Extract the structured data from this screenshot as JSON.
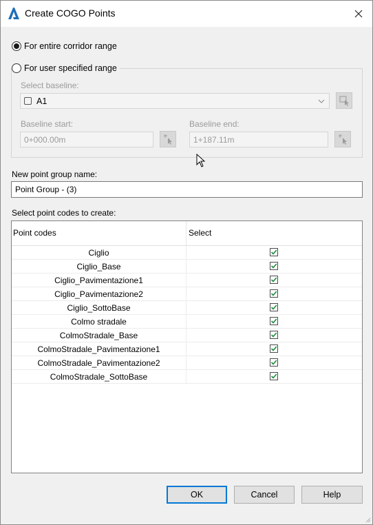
{
  "window": {
    "title": "Create COGO Points"
  },
  "range": {
    "entire": {
      "label": "For entire corridor range",
      "checked": true
    },
    "user": {
      "label": "For user specified range",
      "checked": false
    }
  },
  "baseline": {
    "label": "Select baseline:",
    "value": "A1",
    "start_label": "Baseline start:",
    "start_value": "0+000.00m",
    "end_label": "Baseline end:",
    "end_value": "1+187.11m"
  },
  "group": {
    "label": "New point group name:",
    "value": "Point Group - (3)"
  },
  "codes": {
    "label": "Select point codes to create:",
    "columns": [
      "Point codes",
      "Select"
    ],
    "rows": [
      {
        "name": "Ciglio",
        "checked": true
      },
      {
        "name": "Ciglio_Base",
        "checked": true
      },
      {
        "name": "Ciglio_Pavimentazione1",
        "checked": true
      },
      {
        "name": "Ciglio_Pavimentazione2",
        "checked": true
      },
      {
        "name": "Ciglio_SottoBase",
        "checked": true
      },
      {
        "name": "Colmo stradale",
        "checked": true
      },
      {
        "name": "ColmoStradale_Base",
        "checked": true
      },
      {
        "name": "ColmoStradale_Pavimentazione1",
        "checked": true
      },
      {
        "name": "ColmoStradale_Pavimentazione2",
        "checked": true
      },
      {
        "name": "ColmoStradale_SottoBase",
        "checked": true
      }
    ]
  },
  "buttons": {
    "ok": "OK",
    "cancel": "Cancel",
    "help": "Help"
  },
  "colors": {
    "accent": "#0078d7",
    "check": "#1a8a3a",
    "app_logo": "#1e6fb8"
  }
}
